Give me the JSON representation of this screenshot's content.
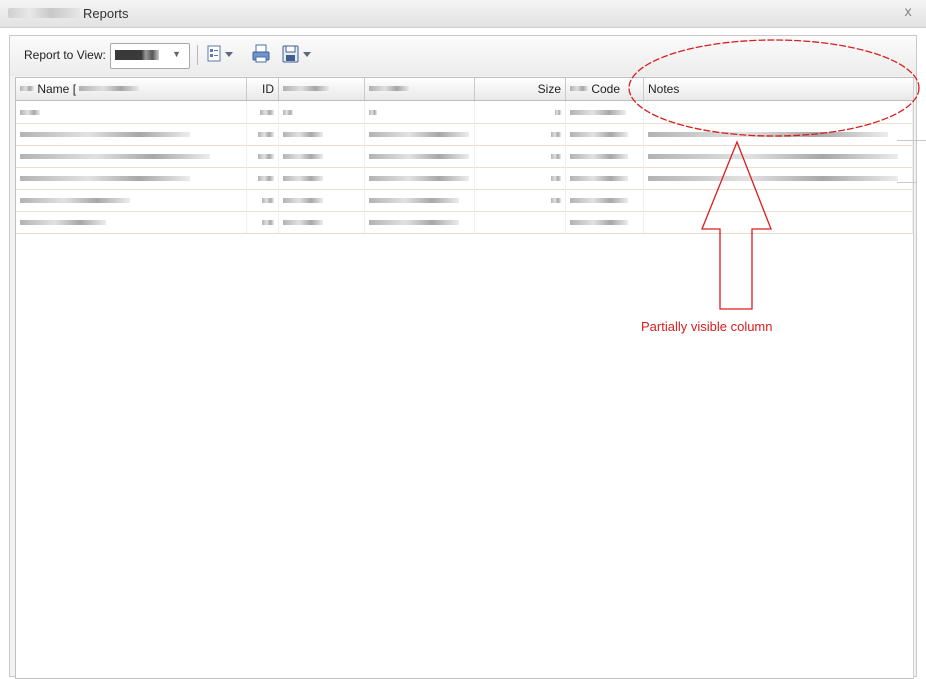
{
  "window": {
    "title": "Reports",
    "close_label": "x"
  },
  "toolbar": {
    "report_label": "Report to View:",
    "report_select_arrow": "▼",
    "icons": [
      "columns-icon",
      "print-icon",
      "save-icon"
    ]
  },
  "grid": {
    "columns": [
      {
        "key": "name",
        "label": "Name ["
      },
      {
        "key": "id",
        "label": "ID"
      },
      {
        "key": "attr",
        "label": ""
      },
      {
        "key": "status",
        "label": ""
      },
      {
        "key": "size",
        "label": "Size"
      },
      {
        "key": "code",
        "label": "Code"
      },
      {
        "key": "notes",
        "label": "Notes"
      }
    ],
    "rows": 6
  },
  "annotation": {
    "label": "Partially visible column",
    "color": "#d81e1e"
  }
}
